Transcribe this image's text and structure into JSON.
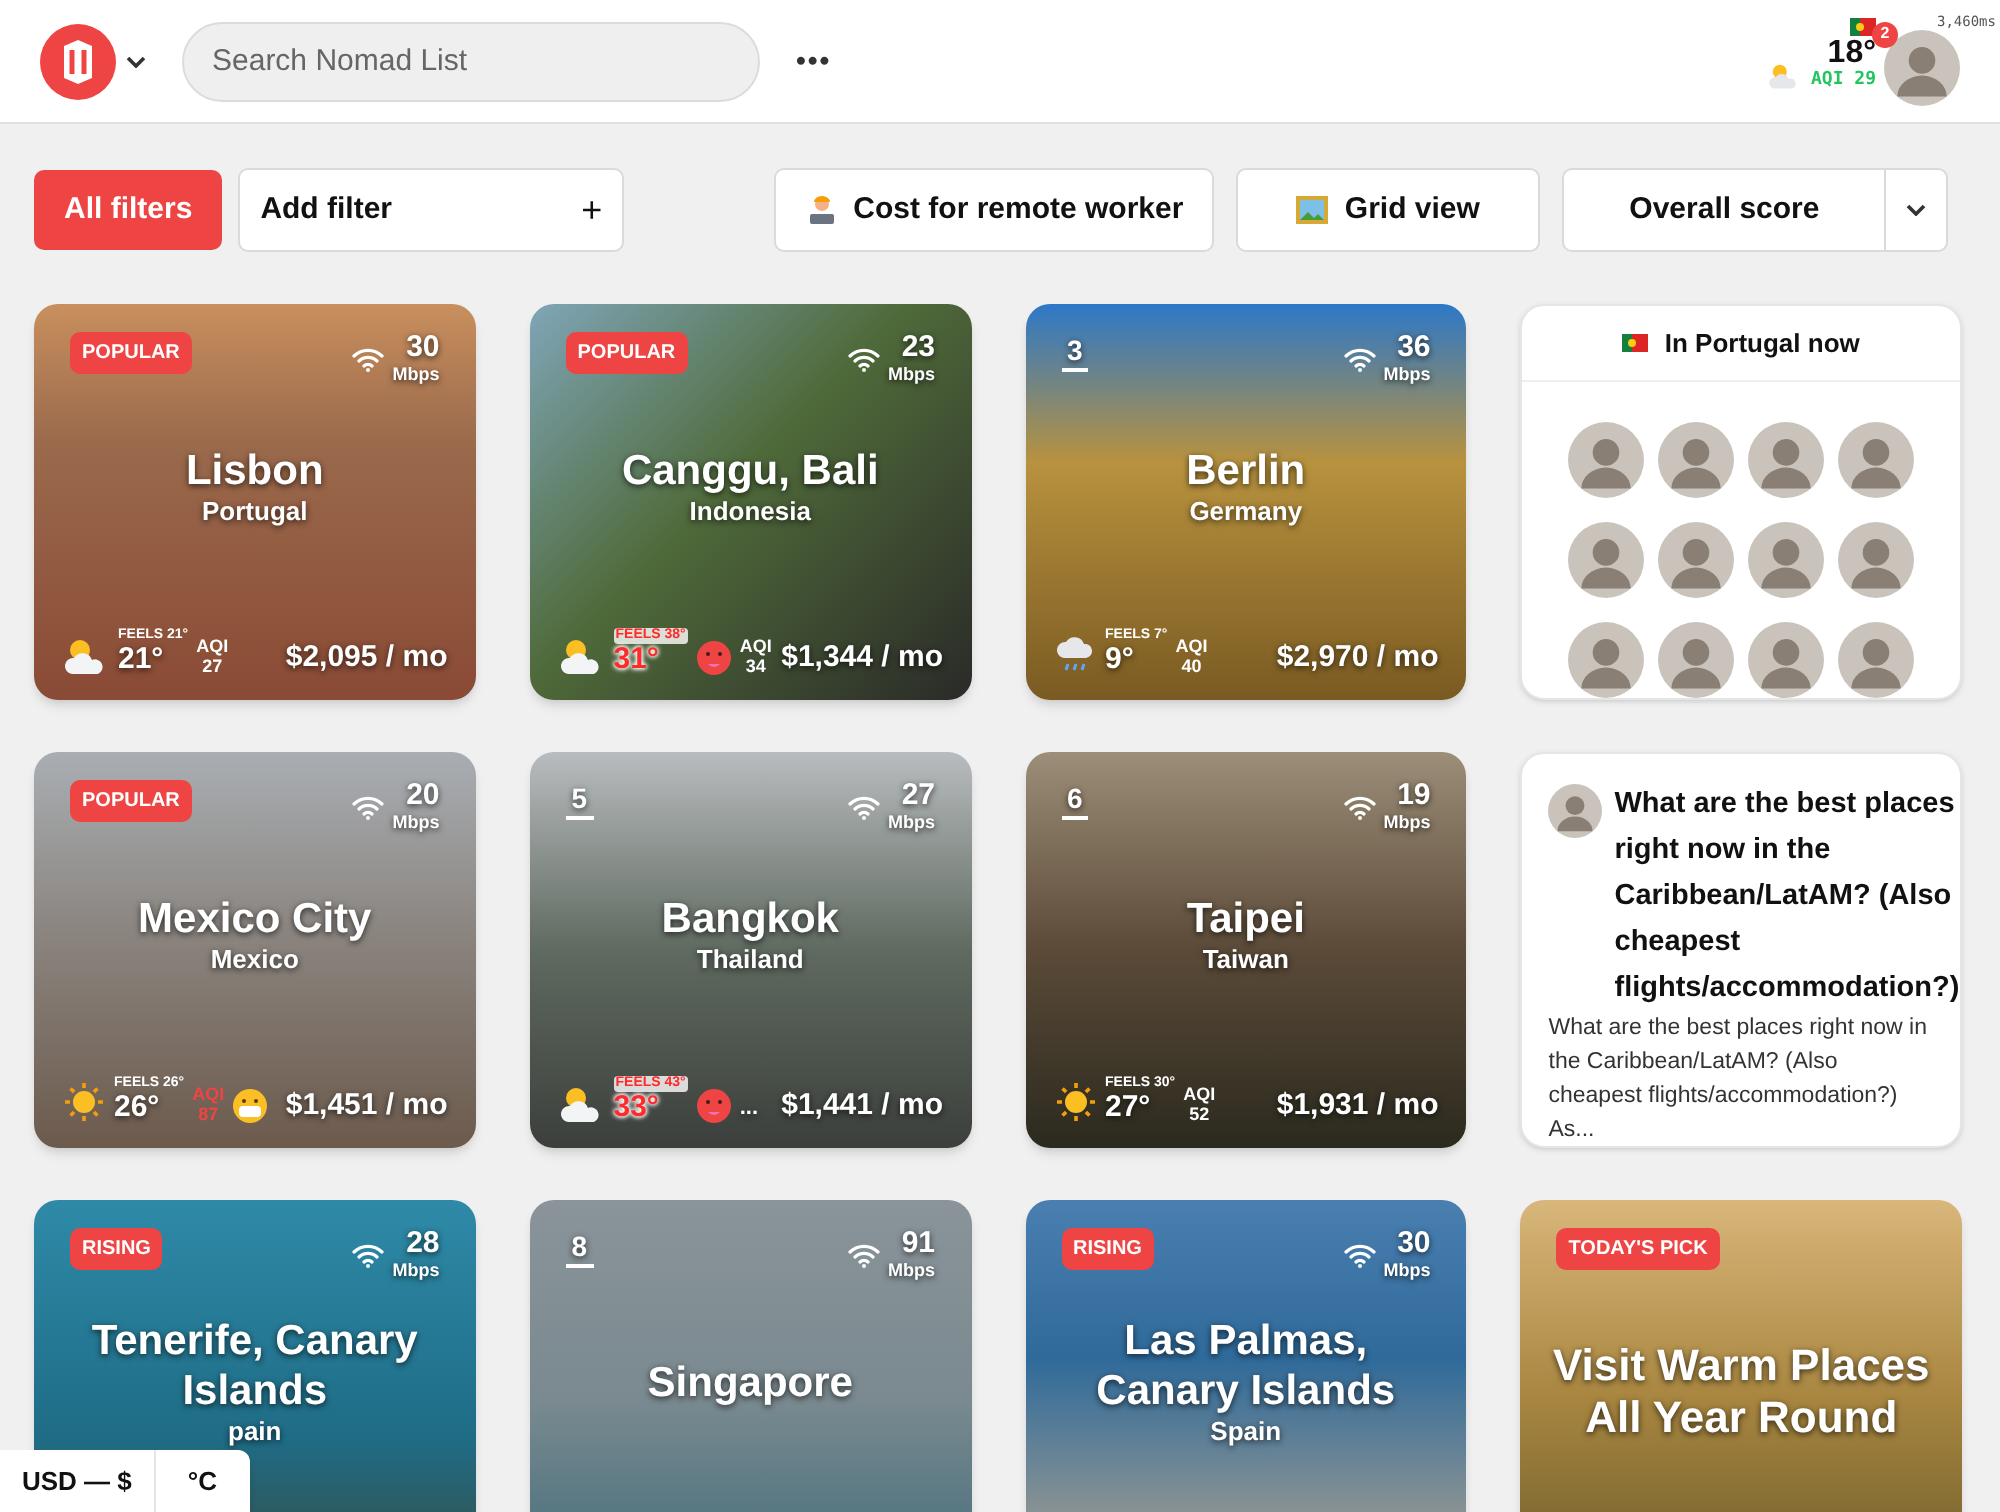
{
  "header": {
    "search": {
      "placeholder": "Search Nomad List"
    },
    "more": "•••",
    "notifications": "2",
    "timing": "3,460ms",
    "temperature": "18°",
    "aqi": "AQI 29"
  },
  "filters": {
    "all_filters": "All filters",
    "add_filter": {
      "label": "Add filter",
      "plus": "+"
    },
    "cost": "Cost for remote worker",
    "view": "Grid view",
    "sort": "Overall score"
  },
  "cards": [
    {
      "kind": "city",
      "badge": {
        "kind": "tag",
        "text": "POPULAR"
      },
      "speed": "30",
      "unit": "Mbps",
      "name": "Lisbon",
      "country": "Portugal",
      "weather": {
        "kind": "sun-cloud"
      },
      "feels": "FEELS 21°",
      "temp": "21°",
      "hot": false,
      "aqi_label": "AQI",
      "aqi": "27",
      "aqi_bad": false,
      "cost": "$2,095 / mo"
    },
    {
      "kind": "city",
      "badge": {
        "kind": "tag",
        "text": "POPULAR"
      },
      "speed": "23",
      "unit": "Mbps",
      "name": "Canggu, Bali",
      "country": "Indonesia",
      "weather": {
        "kind": "sun-cloud"
      },
      "feels": "FEELS 38°",
      "temp": "31°",
      "hot": true,
      "face": {
        "kind": "hot"
      },
      "aqi_label": "AQI",
      "aqi": "34",
      "aqi_bad": false,
      "cost": "$1,344 / mo"
    },
    {
      "kind": "city",
      "badge": {
        "kind": "rank",
        "text": "3"
      },
      "speed": "36",
      "unit": "Mbps",
      "name": "Berlin",
      "country": "Germany",
      "weather": {
        "kind": "rain"
      },
      "feels": "FEELS 7°",
      "temp": "9°",
      "hot": false,
      "aqi_label": "AQI",
      "aqi": "40",
      "aqi_bad": false,
      "cost": "$2,970 / mo"
    },
    {
      "kind": "people",
      "title": "In Portugal now"
    },
    {
      "kind": "city",
      "badge": {
        "kind": "tag",
        "text": "POPULAR"
      },
      "speed": "20",
      "unit": "Mbps",
      "name": "Mexico City",
      "country": "Mexico",
      "weather": {
        "kind": "sun"
      },
      "feels": "FEELS 26°",
      "temp": "26°",
      "hot": false,
      "aqi_label": "AQI",
      "aqi": "87",
      "aqi_bad": true,
      "face": {
        "kind": "mask"
      },
      "cost": "$1,451 / mo"
    },
    {
      "kind": "city",
      "badge": {
        "kind": "rank",
        "text": "5"
      },
      "speed": "27",
      "unit": "Mbps",
      "name": "Bangkok",
      "country": "Thailand",
      "weather": {
        "kind": "sun-cloud"
      },
      "feels": "FEELS 43°",
      "temp": "33°",
      "hot": true,
      "face": {
        "kind": "hot"
      },
      "aqi_more": "...",
      "cost": "$1,441 / mo"
    },
    {
      "kind": "city",
      "badge": {
        "kind": "rank",
        "text": "6"
      },
      "speed": "19",
      "unit": "Mbps",
      "name": "Taipei",
      "country": "Taiwan",
      "weather": {
        "kind": "sun"
      },
      "feels": "FEELS 30°",
      "temp": "27°",
      "hot": false,
      "aqi_label": "AQI",
      "aqi": "52",
      "aqi_bad": false,
      "cost": "$1,931 / mo"
    },
    {
      "kind": "forum",
      "title": "What are the best places right now in the Caribbean/LatAM? (Also cheapest flights/accommodation?)",
      "body": "What are the best places right now in the Caribbean/LatAM? (Also cheapest flights/accommodation?) As..."
    },
    {
      "kind": "city",
      "badge": {
        "kind": "tag",
        "text": "RISING"
      },
      "speed": "28",
      "unit": "Mbps",
      "name": "Tenerife, Canary Islands",
      "country": "pain"
    },
    {
      "kind": "city",
      "badge": {
        "kind": "rank",
        "text": "8"
      },
      "speed": "91",
      "unit": "Mbps",
      "name": "Singapore"
    },
    {
      "kind": "city",
      "badge": {
        "kind": "tag",
        "text": "RISING"
      },
      "speed": "30",
      "unit": "Mbps",
      "name": "Las Palmas, Canary Islands",
      "country": "Spain"
    },
    {
      "kind": "pick",
      "badge": {
        "kind": "tag",
        "text": "TODAY'S PICK"
      },
      "name": "Visit Warm Places All Year Round"
    }
  ],
  "footer": {
    "currency": "USD — $",
    "units": "°C"
  }
}
